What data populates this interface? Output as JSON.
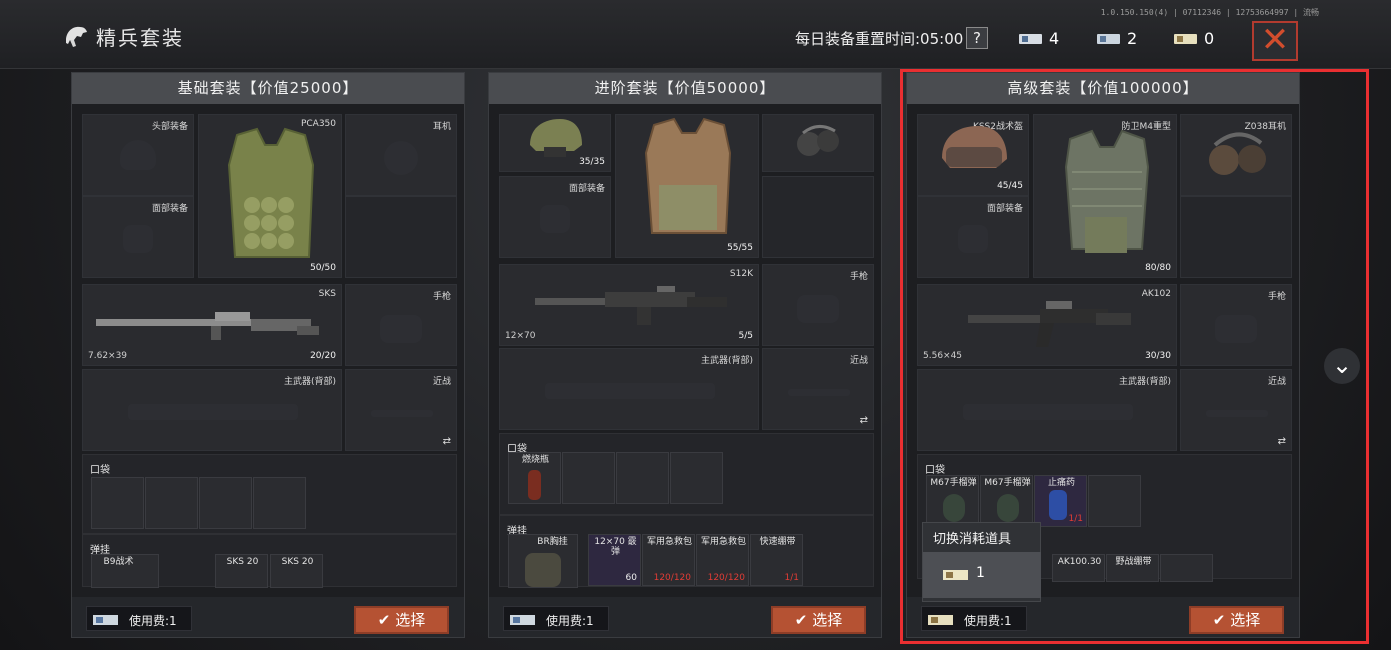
{
  "header": {
    "title": "精兵套装",
    "version": "1.0.150.150(4) | 07112346 | 12753664997 | 流畅",
    "reset_text": "每日装备重置时间:05:00",
    "help": "?",
    "currencies": [
      "4",
      "2",
      "0"
    ],
    "close": "✕"
  },
  "panels": [
    {
      "title": "基础套装【价值25000】",
      "fee": "使用费:1",
      "select": "选择",
      "slots": {
        "helmet": "头部装备",
        "armor_name": "PCA350",
        "armor_dur": "50/50",
        "earphone": "耳机",
        "face": "面部装备",
        "weapon_name": "SKS",
        "weapon_cal": "7.62×39",
        "weapon_ammo": "20/20",
        "pistol": "手枪",
        "backup": "主武器(背部)",
        "melee": "近战",
        "pocket": "口袋",
        "ammo_rig": "弹挂",
        "rig_name": "B9战术",
        "mag1": "SKS 20",
        "mag2": "SKS 20"
      }
    },
    {
      "title": "进阶套装【价值50000】",
      "fee": "使用费:1",
      "select": "选择",
      "slots": {
        "helmet_dur": "35/35",
        "armor_dur": "55/55",
        "face": "面部装备",
        "weapon_name": "S12K",
        "weapon_cal": "12×70",
        "weapon_ammo": "5/5",
        "pistol": "手枪",
        "backup": "主武器(背部)",
        "melee": "近战",
        "pocket": "口袋",
        "pocket_item": "燃烧瓶",
        "ammo_rig": "弹挂",
        "rig_name": "BR胸挂",
        "item1": "12×70 霰弹",
        "item1_num": "60",
        "item2": "军用急救包",
        "item2_num": "120/120",
        "item3": "军用急救包",
        "item3_num": "120/120",
        "item4": "快速绷带",
        "item4_num": "1/1"
      }
    },
    {
      "title": "高级套装【价值100000】",
      "fee": "使用费:1",
      "select": "选择",
      "slots": {
        "helmet_name": "KSS2战术盔",
        "helmet_dur": "45/45",
        "armor_name": "防卫M4重型",
        "armor_dur": "80/80",
        "earphone_name": "Z038耳机",
        "face": "面部装备",
        "weapon_name": "AK102",
        "weapon_cal": "5.56×45",
        "weapon_ammo": "30/30",
        "pistol": "手枪",
        "backup": "主武器(背部)",
        "melee": "近战",
        "pocket": "口袋",
        "p1": "M67手榴弹",
        "p2": "M67手榴弹",
        "p3": "止痛药",
        "p3_num": "1/1",
        "mag": "AK100.30",
        "bandage": "野战绷带"
      },
      "tooltip": {
        "title": "切换消耗道具",
        "count": "1"
      }
    }
  ],
  "colors": {
    "accent": "#b55233",
    "highlight": "#ea2f31",
    "close": "#d24d2d"
  }
}
